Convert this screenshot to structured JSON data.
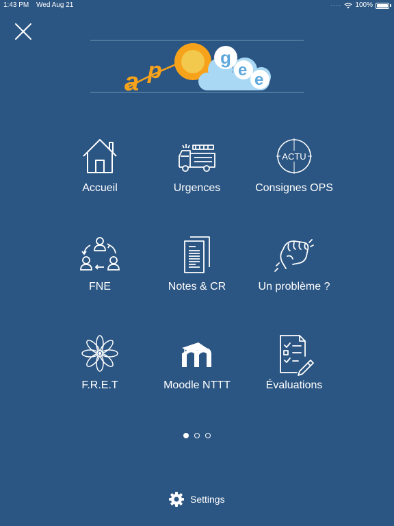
{
  "status_bar": {
    "time": "1:43 PM",
    "date": "Wed Aug 21",
    "battery": "100%"
  },
  "logo": {
    "text_left": "a",
    "text_p": "p",
    "letter_g": "g",
    "letter_e1": "e",
    "letter_e2": "e"
  },
  "menu": {
    "items": [
      {
        "label": "Accueil",
        "icon": "home-icon"
      },
      {
        "label": "Urgences",
        "icon": "fire-truck-icon"
      },
      {
        "label": "Consignes OPS",
        "icon": "actu-icon",
        "icon_text": "ACTU"
      },
      {
        "label": "FNE",
        "icon": "team-cycle-icon"
      },
      {
        "label": "Notes & CR",
        "icon": "documents-icon"
      },
      {
        "label": "Un problème ?",
        "icon": "clenched-fist-icon"
      },
      {
        "label": "F.R.E.T",
        "icon": "flower-icon"
      },
      {
        "label": "Moodle NTTT",
        "icon": "moodle-icon"
      },
      {
        "label": "Évaluations",
        "icon": "evaluation-checklist-icon"
      }
    ]
  },
  "pagination": {
    "pages": 3,
    "current": 1
  },
  "settings": {
    "label": "Settings",
    "icon": "gear-icon"
  },
  "colors": {
    "background": "#2b5582",
    "logo_orange": "#f7a21b",
    "logo_cloud": "#a9d8f5"
  }
}
